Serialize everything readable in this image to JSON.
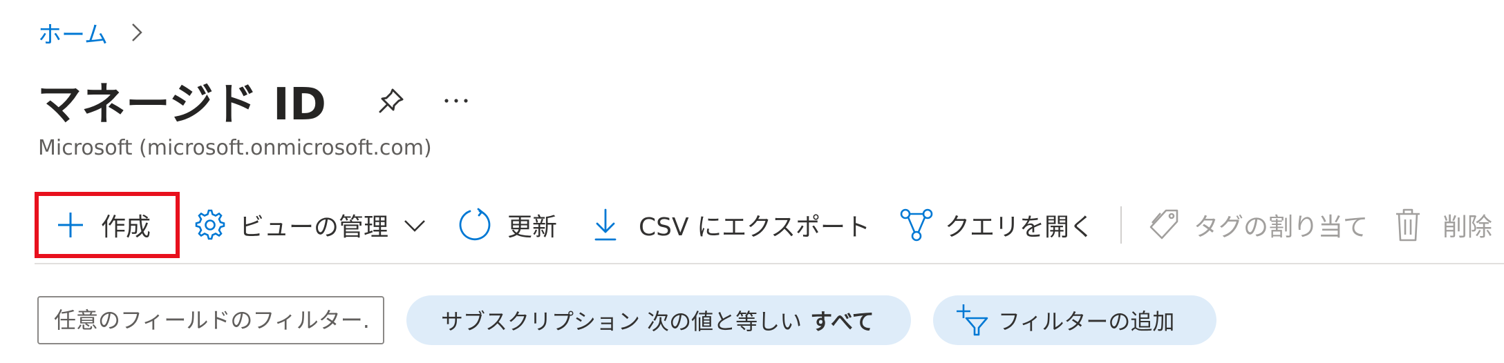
{
  "breadcrumb": {
    "home": "ホーム",
    "separator_icon": "chevron-right-icon"
  },
  "header": {
    "title": "マネージド ID",
    "subtitle": "Microsoft (microsoft.onmicrosoft.com)",
    "pin_icon": "pin-icon",
    "more_icon": "more-icon"
  },
  "toolbar": {
    "create": "作成",
    "manage_view": "ビューの管理",
    "refresh": "更新",
    "export_csv": "CSV にエクスポート",
    "open_query": "クエリを開く",
    "assign_tags": "タグの割り当て",
    "delete": "削除"
  },
  "filters": {
    "search_placeholder": "任意のフィールドのフィルター...",
    "subscription_prefix": "サブスクリプション 次の値と等しい",
    "subscription_value": "すべて",
    "add_filter": "フィルターの追加"
  },
  "colors": {
    "accent": "#0078d4",
    "highlight_box": "#e8101d",
    "pill_bg": "#deecf9",
    "disabled_text": "#a19f9d"
  }
}
